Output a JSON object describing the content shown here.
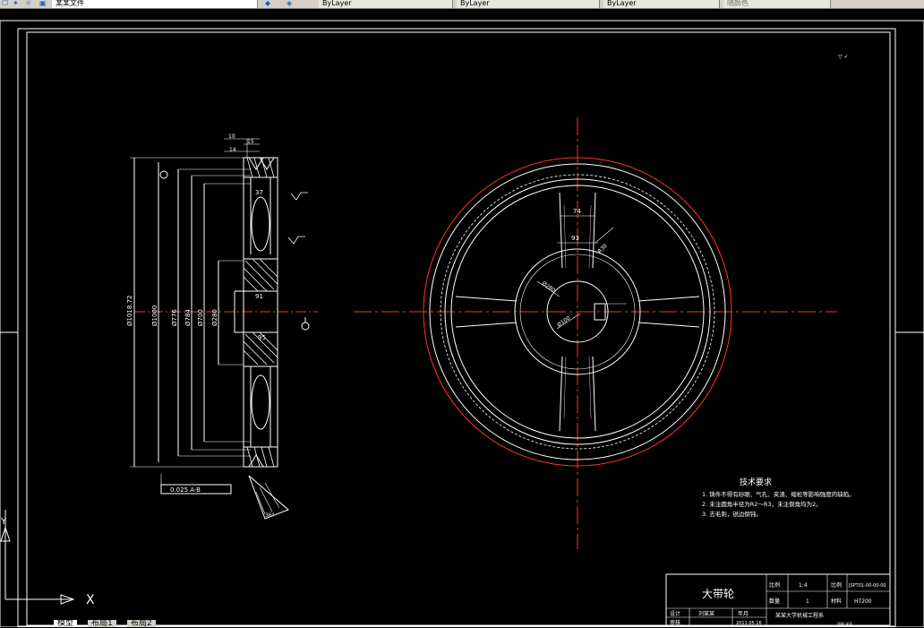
{
  "toolbar": {
    "file_label": "某某文件",
    "layer_box_1": "ByLayer",
    "layer_box_2": "ByLayer",
    "layer_box_3": "ByLayer",
    "plot_style": "随颜色"
  },
  "layout_tabs": [
    "模型",
    "布局1",
    "布局2"
  ],
  "drawing": {
    "dims_section": [
      "10",
      "15",
      "14",
      "37",
      "Ø1018.72",
      "Ø1000",
      "Ø776",
      "Ø784",
      "Ø700",
      "Ø280",
      "91",
      "95",
      "36°"
    ],
    "tolerance_frame": "0.025 A-B",
    "dims_front": [
      "74",
      "93",
      "R30",
      "Ø280",
      "Ø100"
    ],
    "tech_title": "技术要求",
    "tech_notes": [
      "1. 铸件不得有砂眼、气孔、夹渣、缩松等影响强度的缺陷。",
      "2. 未注圆角半径为R2～R3，未注倒角均为2。",
      "3. 去毛刺，锐边倒钝。"
    ],
    "title_block": {
      "part_name": "大带轮",
      "ratio_label": "比例",
      "ratio": "1:4",
      "drawing_no": "JSPT01-00-00-00",
      "qty_label": "数量",
      "qty": "1",
      "material_label": "材料",
      "material": "HT200",
      "designer_label": "设计",
      "designer": "刘某某",
      "date_label": "年月",
      "checker_label": "审核",
      "date": "2011.05.16",
      "school": "某某大学机械工程系",
      "class": "班级 学号"
    }
  }
}
